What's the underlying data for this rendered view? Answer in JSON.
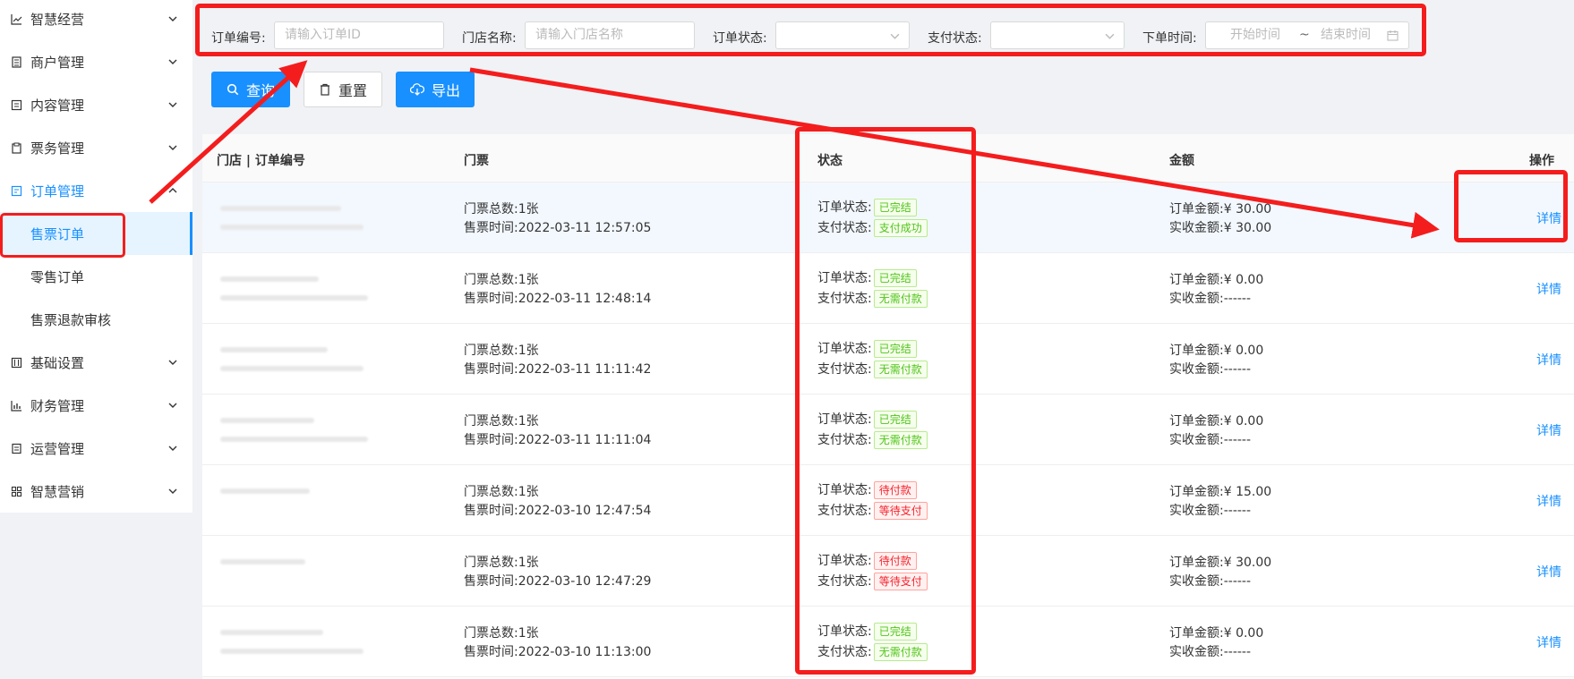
{
  "sidebar": {
    "menus": [
      {
        "label": "智慧经营",
        "icon": "chart-line-icon"
      },
      {
        "label": "商户管理",
        "icon": "store-icon"
      },
      {
        "label": "内容管理",
        "icon": "document-icon"
      },
      {
        "label": "票务管理",
        "icon": "ticket-icon"
      },
      {
        "label": "订单管理",
        "icon": "order-icon"
      },
      {
        "label": "基础设置",
        "icon": "settings-icon"
      },
      {
        "label": "财务管理",
        "icon": "bar-chart-icon"
      },
      {
        "label": "运营管理",
        "icon": "operation-icon"
      },
      {
        "label": "智慧营销",
        "icon": "grid-icon"
      }
    ],
    "submenu": [
      "售票订单",
      "零售订单",
      "售票退款审核"
    ]
  },
  "filters": {
    "order_no_label": "订单编号:",
    "order_no_placeholder": "请输入订单ID",
    "store_label": "门店名称:",
    "store_placeholder": "请输入门店名称",
    "order_status_label": "订单状态:",
    "pay_status_label": "支付状态:",
    "time_label": "下单时间:",
    "start_placeholder": "开始时间",
    "range_sep": "~",
    "end_placeholder": "结束时间"
  },
  "buttons": {
    "query": "查询",
    "reset": "重置",
    "export": "导出"
  },
  "table": {
    "headers": {
      "store_order": "门店 | 订单编号",
      "ticket": "门票",
      "status": "状态",
      "amount": "金额",
      "action": "操作"
    },
    "rows": [
      {
        "ticket_count": "门票总数:1张",
        "sell_time": "售票时间:2022-03-11 12:57:05",
        "order_status": "已完结",
        "order_color": "green",
        "pay_status": "支付成功",
        "pay_color": "green",
        "order_amount": "订单金额:¥ 30.00",
        "received": "实收金额:¥ 30.00",
        "action": "详情"
      },
      {
        "ticket_count": "门票总数:1张",
        "sell_time": "售票时间:2022-03-11 12:48:14",
        "order_status": "已完结",
        "order_color": "green",
        "pay_status": "无需付款",
        "pay_color": "green",
        "order_amount": "订单金额:¥ 0.00",
        "received": "实收金额:------",
        "action": "详情"
      },
      {
        "ticket_count": "门票总数:1张",
        "sell_time": "售票时间:2022-03-11 11:11:42",
        "order_status": "已完结",
        "order_color": "green",
        "pay_status": "无需付款",
        "pay_color": "green",
        "order_amount": "订单金额:¥ 0.00",
        "received": "实收金额:------",
        "action": "详情"
      },
      {
        "ticket_count": "门票总数:1张",
        "sell_time": "售票时间:2022-03-11 11:11:04",
        "order_status": "已完结",
        "order_color": "green",
        "pay_status": "无需付款",
        "pay_color": "green",
        "order_amount": "订单金额:¥ 0.00",
        "received": "实收金额:------",
        "action": "详情"
      },
      {
        "ticket_count": "门票总数:1张",
        "sell_time": "售票时间:2022-03-10 12:47:54",
        "order_status": "待付款",
        "order_color": "red",
        "pay_status": "等待支付",
        "pay_color": "red",
        "order_amount": "订单金额:¥ 15.00",
        "received": "实收金额:------",
        "action": "详情"
      },
      {
        "ticket_count": "门票总数:1张",
        "sell_time": "售票时间:2022-03-10 12:47:29",
        "order_status": "待付款",
        "order_color": "red",
        "pay_status": "等待支付",
        "pay_color": "red",
        "order_amount": "订单金额:¥ 30.00",
        "received": "实收金额:------",
        "action": "详情"
      },
      {
        "ticket_count": "门票总数:1张",
        "sell_time": "售票时间:2022-03-10 11:13:00",
        "order_status": "已完结",
        "order_color": "green",
        "pay_status": "无需付款",
        "pay_color": "green",
        "order_amount": "订单金额:¥ 0.00",
        "received": "实收金额:------",
        "action": "详情"
      }
    ],
    "order_status_prefix": "订单状态:",
    "pay_status_prefix": "支付状态:"
  },
  "colors": {
    "primary": "#1890ff",
    "annotation": "#f41d1d",
    "success": "#52c41a",
    "danger": "#f5222d"
  }
}
